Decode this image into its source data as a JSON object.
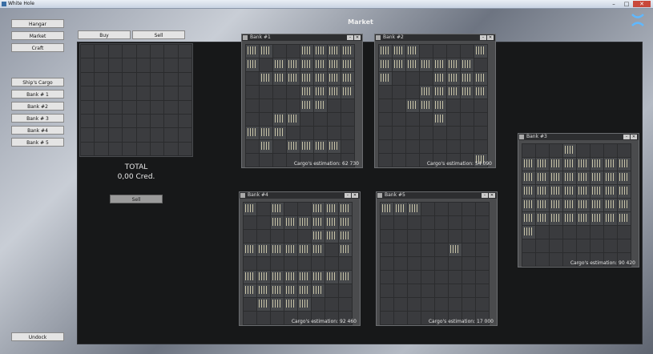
{
  "window": {
    "title": "White Hole",
    "min": "–",
    "max": "□",
    "close": "✕"
  },
  "screen_title": "Market",
  "logo_icon": "swirl-logo-icon",
  "sidebar": {
    "items": [
      {
        "label": "Hangar"
      },
      {
        "label": "Market"
      },
      {
        "label": "Craft"
      },
      {
        "label": "Ship's Cargo"
      },
      {
        "label": "Bank # 1"
      },
      {
        "label": "Bank #2"
      },
      {
        "label": "Bank # 3"
      },
      {
        "label": "Bank #4"
      },
      {
        "label": "Bank # 5"
      }
    ],
    "undock": "Undock"
  },
  "trade": {
    "buy_tab": "Buy",
    "sell_tab": "Sell",
    "total_label": "TOTAL",
    "total_value": "0,00 Cred.",
    "sell_button": "Sell"
  },
  "banks": [
    {
      "name": "Bank #1",
      "estimation_label": "Cargo's estimation:",
      "estimation": "62 730"
    },
    {
      "name": "Bank #2",
      "estimation_label": "Cargo's estimation:",
      "estimation": "54 090"
    },
    {
      "name": "Bank #3",
      "estimation_label": "Cargo's estimation:",
      "estimation": "90 420"
    },
    {
      "name": "Bank #4",
      "estimation_label": "Cargo's estimation:",
      "estimation": "92 460"
    },
    {
      "name": "Bank #5",
      "estimation_label": "Cargo's estimation:",
      "estimation": "17 000"
    }
  ]
}
